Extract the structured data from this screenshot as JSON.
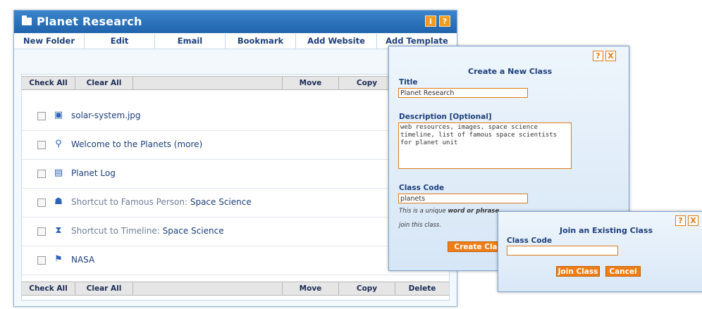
{
  "window": {
    "title": "Planet Research"
  },
  "toolbar_buttons": {
    "info": "i",
    "help": "?"
  },
  "menu": [
    "New Folder",
    "Edit",
    "Email",
    "Bookmark",
    "Add Website",
    "Add Template"
  ],
  "list_header": {
    "check_all": "Check All",
    "clear_all": "Clear All",
    "move": "Move",
    "copy": "Copy",
    "delete": "Delete"
  },
  "items": [
    {
      "icon": "image-file-icon",
      "glyph": "▣",
      "prefix": "",
      "label": "solar-system.jpg"
    },
    {
      "icon": "paperclip-icon",
      "glyph": "⚲",
      "prefix": "",
      "label": "Welcome to the Planets (more)"
    },
    {
      "icon": "log-icon",
      "glyph": "▤",
      "prefix": "",
      "label": "Planet Log"
    },
    {
      "icon": "person-shortcut-icon",
      "glyph": "☗",
      "prefix": "Shortcut to Famous Person: ",
      "label": "Space Science"
    },
    {
      "icon": "hourglass-icon",
      "glyph": "⧗",
      "prefix": "Shortcut to Timeline: ",
      "label": "Space Science"
    },
    {
      "icon": "rocket-icon",
      "glyph": "⚑",
      "prefix": "",
      "label": "NASA"
    }
  ],
  "create_dialog": {
    "help": "?",
    "close": "X",
    "heading": "Create a New Class",
    "title_label": "Title",
    "title_value": "Planet Research",
    "description_label": "Description [Optional]",
    "description_value": "web resources, images, space science timeline, list of famous space scientists for planet unit",
    "class_code_label": "Class Code",
    "class_code_value": "planets",
    "note_line1_a": "This is a unique ",
    "note_line1_b": "word or phrase",
    "note_line2": "join this class.",
    "create_button": "Create Cla"
  },
  "join_dialog": {
    "help": "?",
    "close": "X",
    "heading": "Join an Existing Class",
    "class_code_label": "Class Code",
    "class_code_value": "",
    "join_button": "Join Class",
    "cancel_button": "Cancel"
  }
}
